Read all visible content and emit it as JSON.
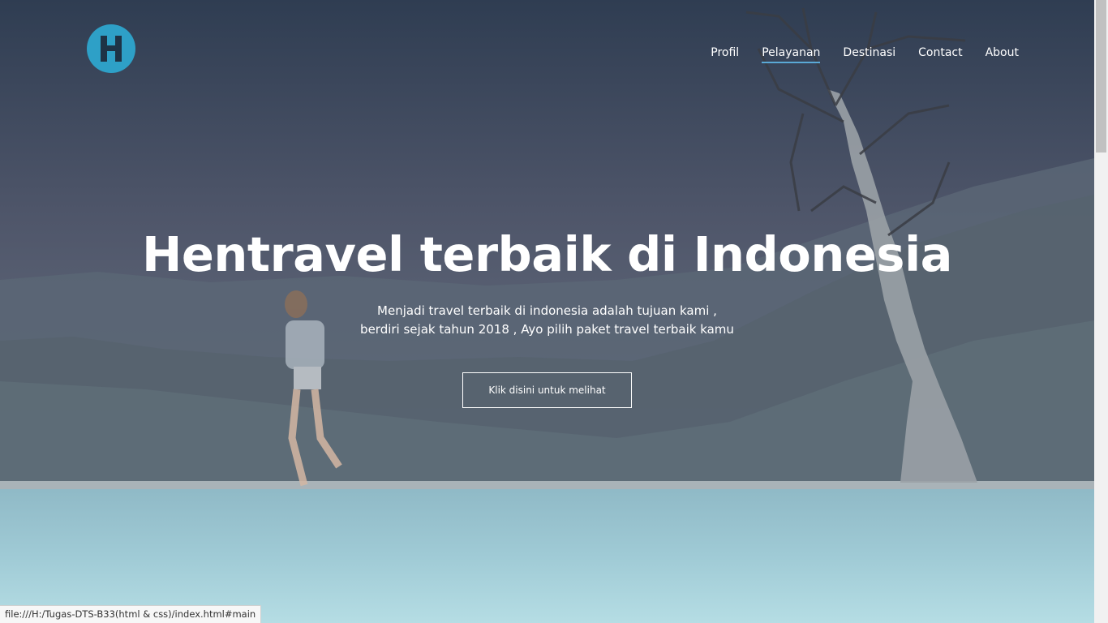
{
  "header": {
    "logo_icon": "h-logo-icon",
    "logo_colors": {
      "circle": "#2ea0c7",
      "letter": "#1e3346"
    }
  },
  "nav": {
    "items": [
      {
        "label": "Profil"
      },
      {
        "label": "Pelayanan",
        "active": true
      },
      {
        "label": "Destinasi"
      },
      {
        "label": "Contact"
      },
      {
        "label": "About"
      }
    ],
    "active_underline_color": "#5aa9d6"
  },
  "hero": {
    "title": "Hentravel terbaik di Indonesia",
    "subtitle_line1": "Menjadi travel terbaik di indonesia adalah tujuan kami ,",
    "subtitle_line2": "berdiri sejak tahun 2018 , Ayo pilih paket travel terbaik kamu",
    "cta_label": "Klik disini untuk melihat"
  },
  "status_bar": {
    "url": "file:///H:/Tugas-DTS-B33(html & css)/index.html#main"
  }
}
